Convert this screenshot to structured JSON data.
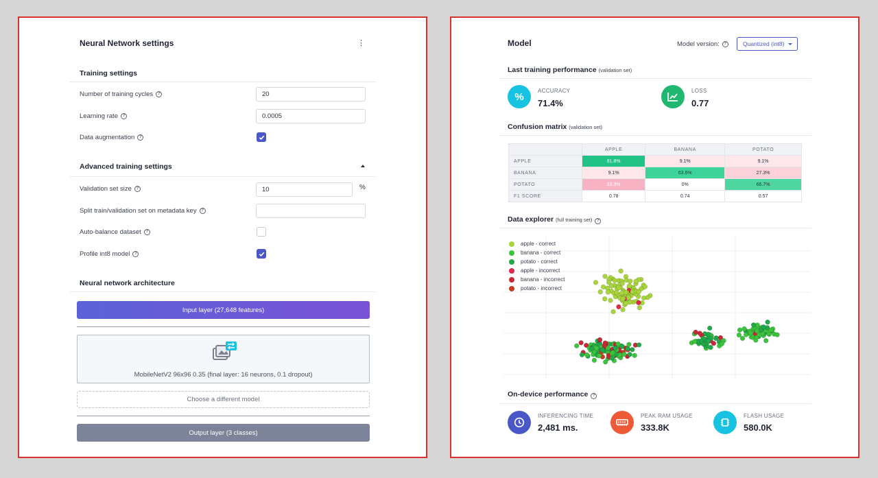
{
  "left": {
    "title": "Neural Network settings",
    "training": {
      "title": "Training settings",
      "cycles_label": "Number of training cycles",
      "cycles_value": "20",
      "lr_label": "Learning rate",
      "lr_value": "0.0005",
      "aug_label": "Data augmentation",
      "aug_checked": true
    },
    "advanced": {
      "title": "Advanced training settings",
      "val_label": "Validation set size",
      "val_value": "10",
      "val_unit": "%",
      "split_label": "Split train/validation set on metadata key",
      "split_value": "",
      "balance_label": "Auto-balance dataset",
      "balance_checked": false,
      "profile_label": "Profile int8 model",
      "profile_checked": true
    },
    "architecture": {
      "title": "Neural network architecture",
      "input_layer": "Input layer (27,648 features)",
      "model_desc": "MobileNetV2 96x96 0.35 (final layer: 16 neurons, 0.1 dropout)",
      "choose_model": "Choose a different model",
      "output_layer": "Output layer (3 classes)"
    }
  },
  "right": {
    "title": "Model",
    "version_label": "Model version:",
    "version_value": "Quantized (int8)",
    "last_perf": {
      "title": "Last training performance",
      "note": "(validation set)"
    },
    "accuracy": {
      "label": "ACCURACY",
      "value": "71.4%"
    },
    "loss": {
      "label": "LOSS",
      "value": "0.77"
    },
    "confusion": {
      "title": "Confusion matrix",
      "note": "(validation set)",
      "columns": [
        "APPLE",
        "BANANA",
        "POTATO"
      ],
      "rows": [
        {
          "label": "APPLE",
          "cells": [
            "81.8%",
            "9.1%",
            "9.1%"
          ]
        },
        {
          "label": "BANANA",
          "cells": [
            "9.1%",
            "63.6%",
            "27.3%"
          ]
        },
        {
          "label": "POTATO",
          "cells": [
            "33.3%",
            "0%",
            "66.7%"
          ]
        },
        {
          "label": "F1 SCORE",
          "cells": [
            "0.78",
            "0.74",
            "0.57"
          ]
        }
      ]
    },
    "explorer": {
      "title": "Data explorer",
      "note": "(full training set)",
      "legend": [
        {
          "label": "apple - correct",
          "color": "#a8d43c"
        },
        {
          "label": "banana - correct",
          "color": "#3cc43c"
        },
        {
          "label": "potato - correct",
          "color": "#20a84a"
        },
        {
          "label": "apple - incorrect",
          "color": "#e0284a"
        },
        {
          "label": "banana - incorrect",
          "color": "#c82838"
        },
        {
          "label": "potato - incorrect",
          "color": "#c83a22"
        }
      ]
    },
    "device": {
      "title": "On-device performance",
      "inferencing": {
        "label": "INFERENCING TIME",
        "value": "2,481 ms."
      },
      "ram": {
        "label": "PEAK RAM USAGE",
        "value": "333.8K"
      },
      "flash": {
        "label": "FLASH USAGE",
        "value": "580.0K"
      }
    }
  },
  "colors": {
    "accent": "#4a57c6",
    "cyan": "#17c3e0",
    "green": "#20b870",
    "orange": "#ee5a38",
    "matrix_good": "#3ed39a",
    "matrix_bad": "#f7b3c3",
    "matrix_light": "#fde7ea"
  }
}
